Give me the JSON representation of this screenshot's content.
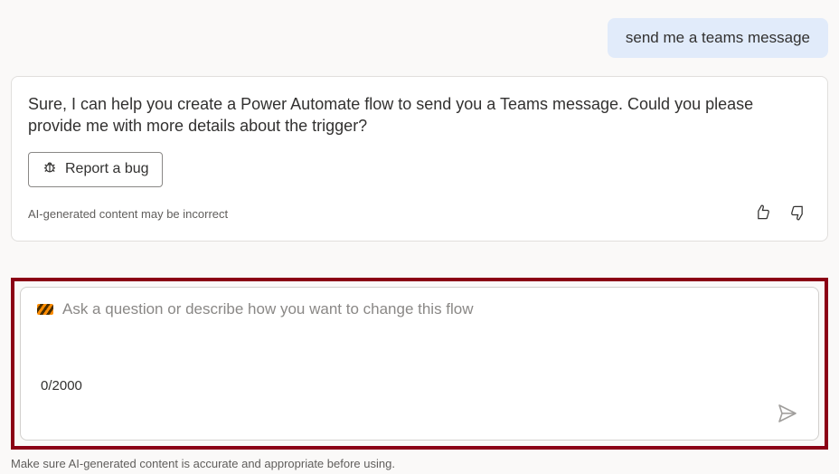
{
  "chat": {
    "user_message": "send me a teams message",
    "ai_message": "Sure, I can help you create a Power Automate flow to send you a Teams message. Could you please provide me with more details about the trigger?",
    "report_bug_label": "Report a bug",
    "ai_disclaimer": "AI-generated content may be incorrect"
  },
  "input": {
    "placeholder": "Ask a question or describe how you want to change this flow",
    "char_counter": "0/2000"
  },
  "footer": {
    "disclaimer": "Make sure AI-generated content is accurate and appropriate before using."
  }
}
